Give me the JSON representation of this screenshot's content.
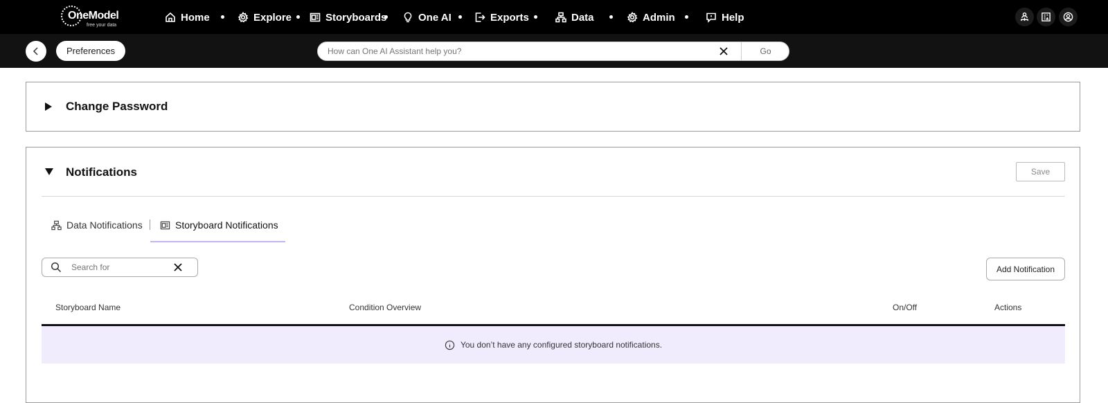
{
  "app": {
    "logo_name": "OneModel",
    "logo_tagline": "free your data"
  },
  "nav": {
    "items": [
      {
        "label": "Home",
        "icon": "home-icon"
      },
      {
        "label": "Explore",
        "icon": "gear-icon"
      },
      {
        "label": "Storyboards",
        "icon": "storyboard-icon"
      },
      {
        "label": "One AI",
        "icon": "lightbulb-icon"
      },
      {
        "label": "Exports",
        "icon": "export-icon"
      },
      {
        "label": "Data",
        "icon": "data-hierarchy-icon"
      },
      {
        "label": "Admin",
        "icon": "gear-icon"
      },
      {
        "label": "Help",
        "icon": "help-comment-icon"
      }
    ],
    "right_icons": [
      "org-chart-icon",
      "building-icon",
      "user-avatar-icon"
    ]
  },
  "subbar": {
    "page_pill": "Preferences",
    "assistant_placeholder": "How can One AI Assistant help you?",
    "go_label": "Go"
  },
  "sections": {
    "change_password": {
      "title": "Change Password",
      "expanded": false
    },
    "notifications": {
      "title": "Notifications",
      "expanded": true,
      "save_label": "Save",
      "tabs": [
        {
          "label": "Data Notifications",
          "icon": "data-hierarchy-icon",
          "active": false
        },
        {
          "label": "Storyboard Notifications",
          "icon": "storyboard-icon",
          "active": true
        }
      ],
      "search_placeholder": "Search for",
      "add_label": "Add Notification",
      "columns": [
        "Storyboard Name",
        "Condition Overview",
        "On/Off",
        "Actions"
      ],
      "empty_message": "You don’t have any configured storyboard notifications."
    }
  },
  "colors": {
    "nav_bg": "#000000",
    "subbar_bg": "#121212",
    "tab_underline": "#c3b3ef",
    "empty_row_bg": "#f1ecfd"
  }
}
